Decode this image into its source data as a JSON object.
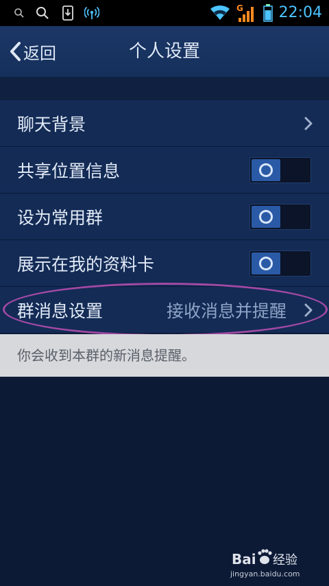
{
  "status_bar": {
    "time": "22:04",
    "network_label": "G",
    "icons": [
      "search-icon",
      "magnifier-icon",
      "download-icon",
      "broadcast-icon",
      "wifi-icon",
      "signal-icon",
      "battery-icon"
    ]
  },
  "header": {
    "back_label": "返回",
    "title": "个人设置"
  },
  "settings": [
    {
      "label": "聊天背景",
      "control": "chevron"
    },
    {
      "label": "共享位置信息",
      "control": "toggle",
      "state": "off"
    },
    {
      "label": "设为常用群",
      "control": "toggle",
      "state": "off"
    },
    {
      "label": "展示在我的资料卡",
      "control": "toggle",
      "state": "off"
    },
    {
      "label": "群消息设置",
      "value": "接收消息并提醒",
      "control": "chevron"
    }
  ],
  "hint": "你会收到本群的新消息提醒。",
  "watermark": {
    "brand_a": "Bai",
    "brand_b": "经验",
    "url": "jingyan.baidu.com"
  },
  "colors": {
    "status_time": "#4dc3ff",
    "background": "#0c1a36",
    "list_background": "#132b55",
    "highlight": "#a349a4",
    "hint_background": "#d6d8dc"
  }
}
